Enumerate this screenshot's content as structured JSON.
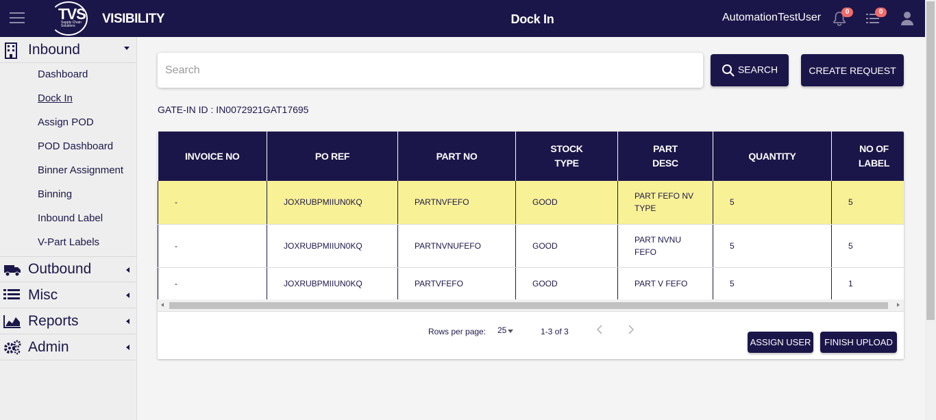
{
  "header": {
    "logo_text": "TVS",
    "logo_sub": "Supply Chain Solutions",
    "app_name": "VISIBILITY",
    "title": "Dock In",
    "user": "AutomationTestUser",
    "notifications_count": "0",
    "tasks_count": "0"
  },
  "sidebar": {
    "groups": [
      {
        "label": "Inbound",
        "icon": "building-icon",
        "expanded": true
      },
      {
        "label": "Outbound",
        "icon": "truck-icon"
      },
      {
        "label": "Misc",
        "icon": "list-icon"
      },
      {
        "label": "Reports",
        "icon": "area-chart-icon"
      },
      {
        "label": "Admin",
        "icon": "gears-icon"
      }
    ],
    "inbound_items": [
      {
        "label": "Dashboard"
      },
      {
        "label": "Dock In"
      },
      {
        "label": "Assign POD"
      },
      {
        "label": "POD Dashboard"
      },
      {
        "label": "Binner Assignment"
      },
      {
        "label": "Binning"
      },
      {
        "label": "Inbound Label"
      },
      {
        "label": "V-Part Labels"
      }
    ]
  },
  "search": {
    "placeholder": "Search",
    "button_label": "SEARCH"
  },
  "create_request_label": "CREATE REQUEST",
  "gate_in": "GATE-IN ID : IN0072921GAT17695",
  "table": {
    "columns": [
      "INVOICE NO",
      "PO REF",
      "PART NO",
      "STOCK TYPE",
      "PART DESC",
      "QUANTITY",
      "NO OF LABEL"
    ],
    "rows": [
      {
        "invoice": "-",
        "po_ref": "JOXRUBPMIIUN0KQ",
        "part_no": "PARTNVFEFO",
        "stock": "GOOD",
        "desc": "PART FEFO NV TYPE",
        "qty": "5",
        "labels": "5"
      },
      {
        "invoice": "-",
        "po_ref": "JOXRUBPMIIUN0KQ",
        "part_no": "PARTNVNUFEFO",
        "stock": "GOOD",
        "desc": "PART NVNU FEFO",
        "qty": "5",
        "labels": "5"
      },
      {
        "invoice": "-",
        "po_ref": "JOXRUBPMIIUN0KQ",
        "part_no": "PARTVFEFO",
        "stock": "GOOD",
        "desc": "PART V FEFO",
        "qty": "5",
        "labels": "1"
      }
    ]
  },
  "pager": {
    "rows_per_page_label": "Rows per page:",
    "rows_per_page": "25",
    "range": "1-3 of 3"
  },
  "actions": {
    "assign_user": "ASSIGN USER",
    "finish_upload": "FINISH UPLOAD"
  },
  "colors": {
    "primary": "#1b1649",
    "selected_row": "#f9f196",
    "badge": "#f06b6b"
  }
}
